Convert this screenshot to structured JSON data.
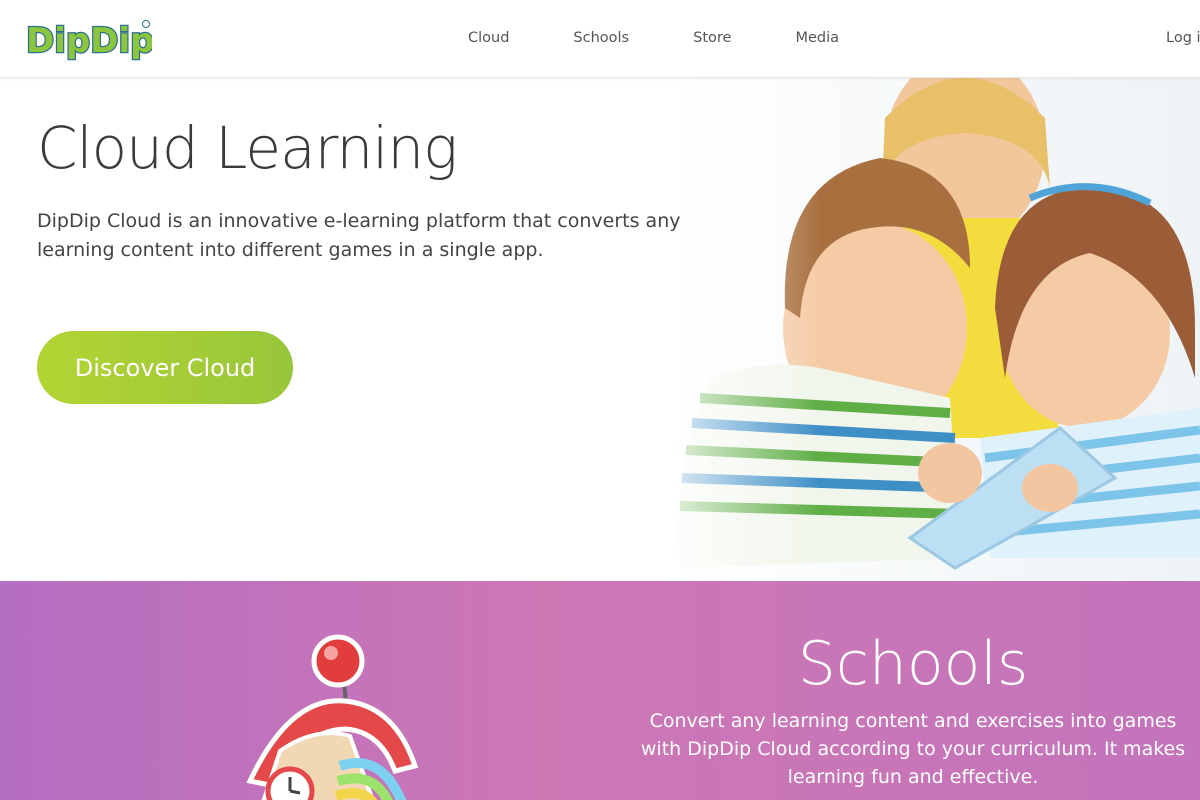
{
  "logo": {
    "text": "DipDip"
  },
  "nav": {
    "links": [
      "Cloud",
      "Schools",
      "Store",
      "Media"
    ],
    "login": "Log in"
  },
  "hero": {
    "title": "Cloud Learning",
    "description": "DipDip Cloud is an innovative e-learning platform that converts any learning content into different games in a single app.",
    "cta_label": "Discover Cloud"
  },
  "schools": {
    "title": "Schools",
    "description": "Convert any learning content and exercises into games with DipDip Cloud according to your curriculum. It makes learning fun and effective."
  },
  "colors": {
    "cta_green": "#a6cd37",
    "schools_purple": "#c374bb",
    "logo_green": "#8cc63f"
  }
}
